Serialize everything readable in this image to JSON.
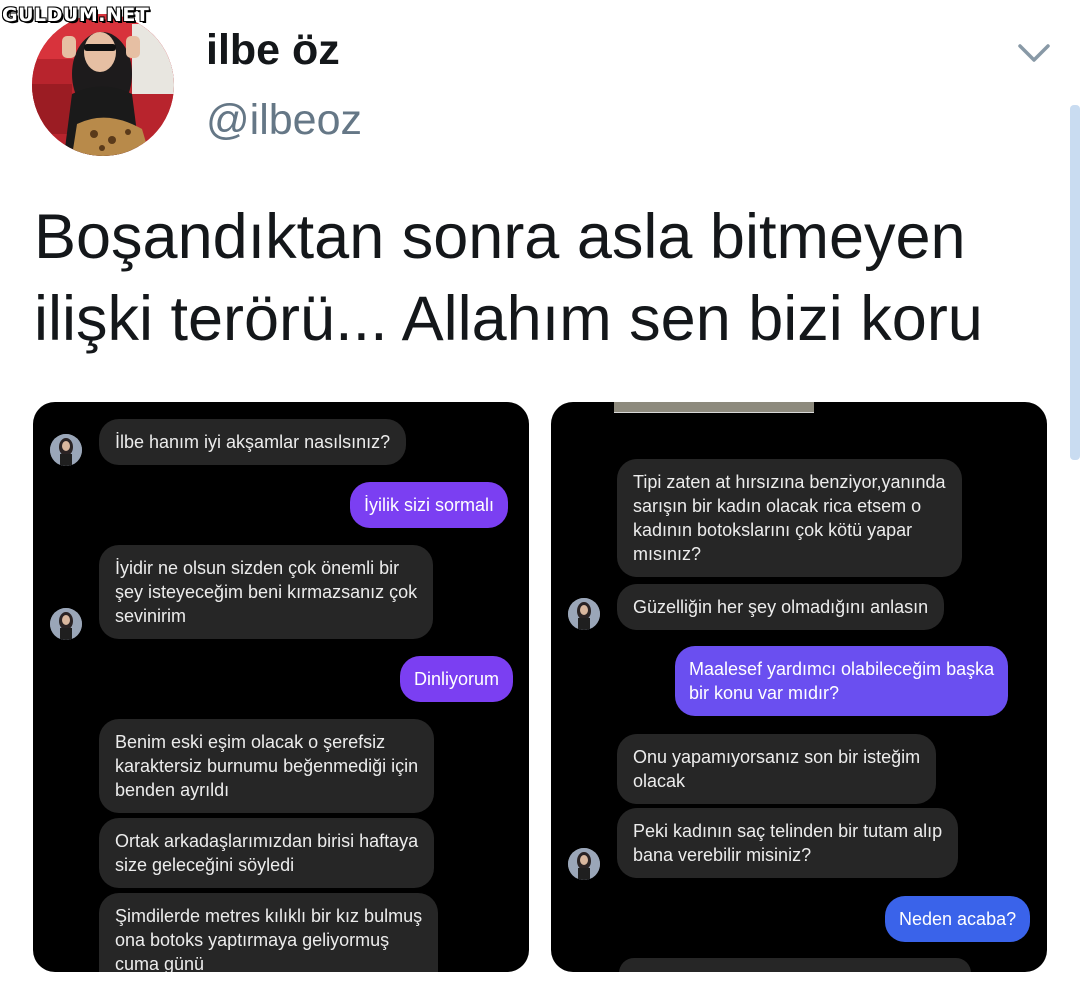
{
  "watermark": "GULDUM.NET",
  "author": {
    "name": "ilbe öz",
    "handle": "@ilbeoz"
  },
  "tweet": {
    "lines": [
      "Boşandıktan sonra asla bitmeyen",
      "ilişki terörü... Allahım sen bizi koru"
    ]
  },
  "left_chat": {
    "messages": [
      {
        "from": "them",
        "lines": [
          "İlbe hanım iyi akşamlar nasılsınız?"
        ]
      },
      {
        "from": "me",
        "lines": [
          "İyilik sizi sormalı"
        ]
      },
      {
        "from": "them",
        "lines": [
          "İyidir ne olsun sizden çok önemli bir",
          "şey isteyeceğim beni kırmazsanız çok",
          "sevinirim"
        ]
      },
      {
        "from": "me",
        "lines": [
          "Dinliyorum"
        ]
      },
      {
        "from": "them",
        "lines": [
          "Benim eski eşim olacak o şerefsiz",
          "karaktersiz burnumu beğenmediği için",
          "benden ayrıldı"
        ]
      },
      {
        "from": "them",
        "lines": [
          "Ortak arkadaşlarımızdan birisi haftaya",
          "size geleceğini söyledi"
        ]
      },
      {
        "from": "them",
        "lines": [
          "Şimdilerde metres kılıklı bir kız bulmuş",
          "ona botoks yaptırmaya geliyormuş",
          "cuma günü"
        ]
      }
    ]
  },
  "right_chat": {
    "messages": [
      {
        "from": "them",
        "lines": [
          "Tipi zaten at hırsızına benziyor,yanında",
          "sarışın bir kadın olacak rica etsem o",
          "kadının botokslarını çok kötü yapar",
          "mısınız?"
        ]
      },
      {
        "from": "them",
        "lines": [
          "Güzelliğin her şey olmadığını anlasın"
        ]
      },
      {
        "from": "me",
        "lines": [
          "Maalesef yardımcı olabileceğim başka",
          "bir konu var mıdır?"
        ]
      },
      {
        "from": "them",
        "lines": [
          "Onu yapamıyorsanız son bir isteğim",
          "olacak"
        ]
      },
      {
        "from": "them",
        "lines": [
          "Peki kadının saç telinden bir tutam alıp",
          "bana verebilir misiniz?"
        ]
      },
      {
        "from": "me",
        "lines": [
          "Neden acaba?"
        ]
      }
    ]
  },
  "colors": {
    "name": "#14171a",
    "handle": "#657786",
    "received_bubble": "#262626",
    "sent_purple": "#7b3ff2",
    "sent_blue": "#3a63ea"
  },
  "icons": {
    "menu": "chevron-down-icon"
  }
}
